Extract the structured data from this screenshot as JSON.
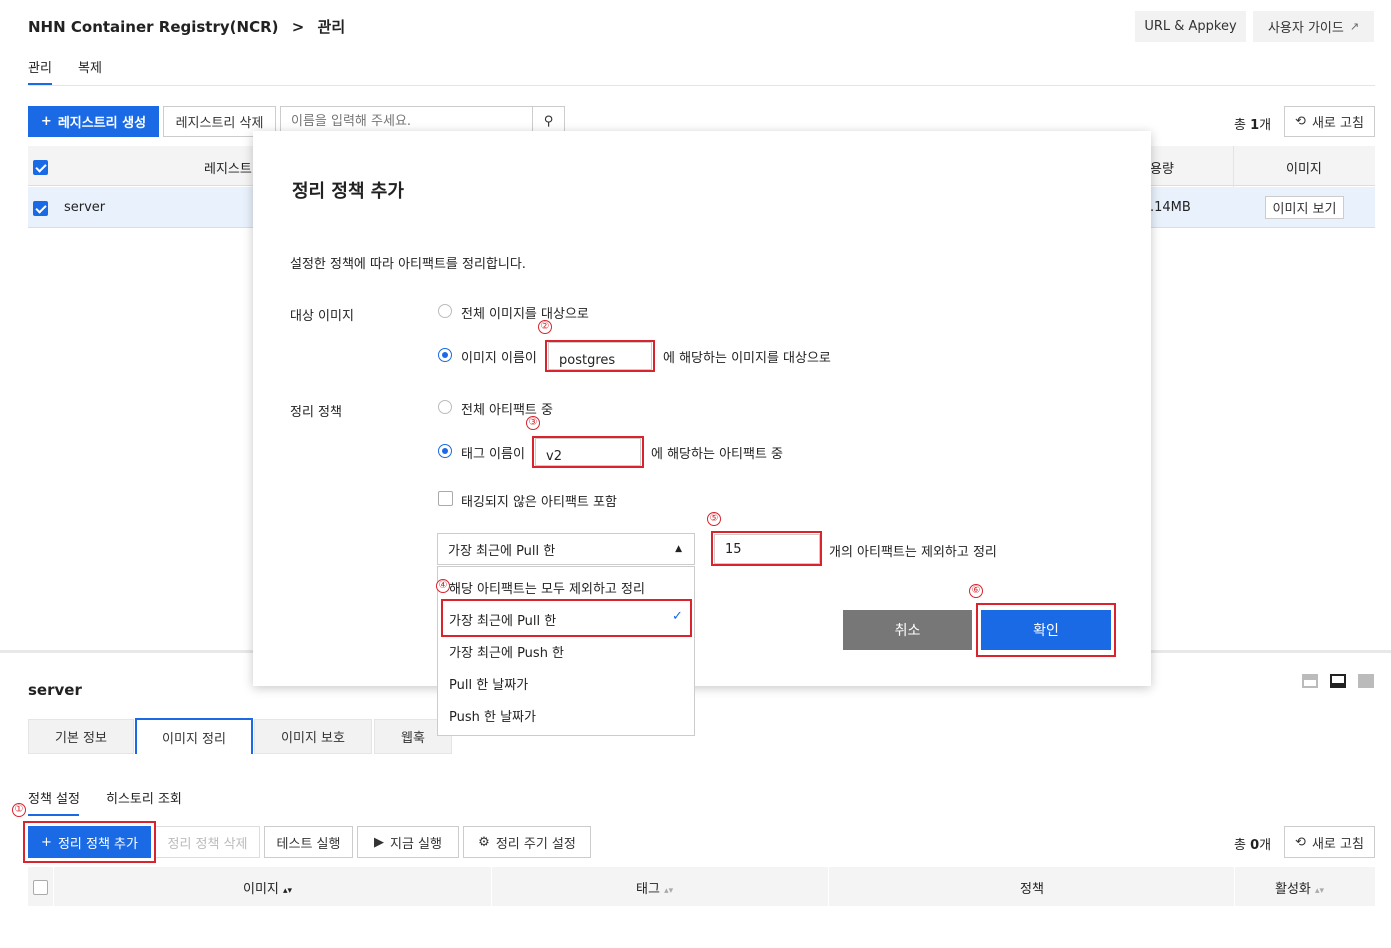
{
  "breadcrumb": {
    "service": "NHN Container Registry(NCR)",
    "separator": ">",
    "current": "관리"
  },
  "header_buttons": {
    "url_appkey": "URL & Appkey",
    "user_guide": "사용자 가이드"
  },
  "top_tabs": [
    "관리",
    "복제"
  ],
  "toolbar": {
    "create_registry": "레지스트리 생성",
    "delete_registry": "레지스트리 삭제",
    "search_placeholder": "이름을 입력해 주세요.",
    "total_prefix": "총 ",
    "total_count": "1",
    "total_suffix": "개",
    "refresh": "새로 고침"
  },
  "registry_table": {
    "headers": {
      "name": "레지스트",
      "size": "용량",
      "image": "이미지"
    },
    "row": {
      "name": "server",
      "size": ".14MB",
      "view_images": "이미지 보기"
    }
  },
  "bottom": {
    "title": "server",
    "tabs": [
      "기본 정보",
      "이미지 정리",
      "이미지 보호",
      "웹훅"
    ],
    "subtabs": [
      "정책 설정",
      "히스토리 조회"
    ],
    "buttons": {
      "add_policy": "정리 정책 추가",
      "delete_policy": "정리 정책 삭제",
      "test_run": "테스트 실행",
      "run_now": "지금 실행",
      "schedule": "정리 주기 설정",
      "refresh": "새로 고침"
    },
    "total_prefix": "총 ",
    "total_count": "0",
    "total_suffix": "개",
    "table_headers": {
      "image": "이미지",
      "tag": "태그",
      "policy": "정책",
      "active": "활성화"
    }
  },
  "modal": {
    "title": "정리 정책 추가",
    "description": "설정한 정책에 따라 아티팩트를 정리합니다.",
    "target_label": "대상 이미지",
    "target_all": "전체 이미지를 대상으로",
    "target_name": "이미지 이름이",
    "target_name_value": "postgres",
    "target_name_suffix": "에 해당하는 이미지를 대상으로",
    "policy_label": "정리 정책",
    "policy_all": "전체 아티팩트 중",
    "policy_tag": "태그 이름이",
    "policy_tag_value": "v2",
    "policy_tag_suffix": "에 해당하는 아티팩트 중",
    "untagged": "태깅되지 않은 아티팩트 포함",
    "select_value": "가장 최근에 Pull 한",
    "count_value": "15",
    "count_suffix": "개의 아티팩트는 제외하고 정리",
    "dropdown_options": [
      "해당 아티팩트는 모두 제외하고 정리",
      "가장 최근에 Pull 한",
      "가장 최근에 Push 한",
      "Pull 한 날짜가",
      "Push 한 날짜가"
    ],
    "cancel": "취소",
    "confirm": "확인"
  },
  "annotations": [
    "①",
    "②",
    "③",
    "④",
    "⑤",
    "⑥"
  ],
  "colors": {
    "accent": "#1a6ae6",
    "annotation": "#d9232d",
    "cancel": "#777777"
  }
}
